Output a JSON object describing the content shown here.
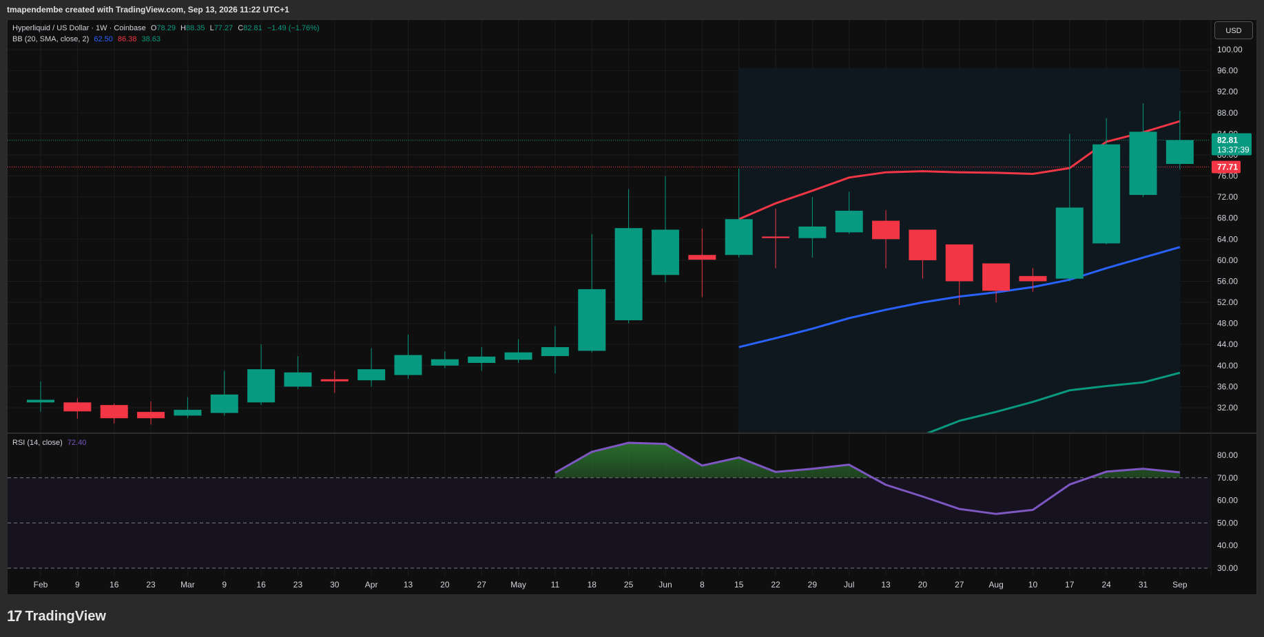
{
  "header": {
    "caption": "tmapendembe created with TradingView.com, Sep 13, 2026 11:22 UTC+1"
  },
  "legend": {
    "symbol": "Hyperliquid / US Dollar · 1W · Coinbase",
    "o_label": "O",
    "o_value": "78.29",
    "h_label": "H",
    "h_value": "88.35",
    "l_label": "L",
    "l_value": "77.27",
    "c_label": "C",
    "c_value": "82.81",
    "change": "−1.49 (−1.76%)",
    "bb_label": "BB (20, SMA, close, 2)",
    "bb_basis": "62.50",
    "bb_upper": "86.38",
    "bb_lower": "38.63",
    "rsi_label": "RSI (14, close)",
    "rsi_value": "72.40"
  },
  "currency_button": "USD",
  "price_tags": {
    "last": "82.81",
    "countdown": "13:37:39",
    "hidden": "80.00",
    "red_line": "77.71"
  },
  "footer": {
    "brand": "TradingView"
  },
  "colors": {
    "up": "#089981",
    "down": "#f23645",
    "bb_upper": "#f23645",
    "bb_basis": "#2962ff",
    "bb_lower": "#089981",
    "rsi": "#7e57c2",
    "background": "#0f0f0f"
  },
  "chart_data": {
    "type": "candlestick",
    "interval": "1W",
    "x_ticks": [
      "Feb",
      "9",
      "16",
      "23",
      "Mar",
      "9",
      "16",
      "23",
      "30",
      "Apr",
      "13",
      "20",
      "27",
      "May",
      "11",
      "18",
      "25",
      "Jun",
      "8",
      "15",
      "22",
      "29",
      "Jul",
      "13",
      "20",
      "27",
      "Aug",
      "10",
      "17",
      "24",
      "31",
      "Sep"
    ],
    "price_axis": {
      "ticks": [
        "100.00",
        "96.00",
        "92.00",
        "88.00",
        "84.00",
        "80.00",
        "76.00",
        "72.00",
        "68.00",
        "64.00",
        "60.00",
        "56.00",
        "52.00",
        "48.00",
        "44.00",
        "40.00",
        "36.00",
        "32.00"
      ],
      "range": [
        28.6,
        103.9
      ]
    },
    "candles": [
      {
        "o": 33.0,
        "h": 37.0,
        "l": 31.2,
        "c": 33.5
      },
      {
        "o": 33.0,
        "h": 33.8,
        "l": 29.9,
        "c": 31.3
      },
      {
        "o": 32.5,
        "h": 32.8,
        "l": 29.0,
        "c": 30.0
      },
      {
        "o": 31.2,
        "h": 33.2,
        "l": 28.8,
        "c": 30.0
      },
      {
        "o": 30.5,
        "h": 34.0,
        "l": 30.0,
        "c": 31.6
      },
      {
        "o": 31.0,
        "h": 39.0,
        "l": 30.5,
        "c": 34.5
      },
      {
        "o": 33.0,
        "h": 44.0,
        "l": 32.5,
        "c": 39.3
      },
      {
        "o": 36.0,
        "h": 41.8,
        "l": 35.5,
        "c": 38.7
      },
      {
        "o": 37.4,
        "h": 39.0,
        "l": 34.8,
        "c": 37.0
      },
      {
        "o": 37.2,
        "h": 43.3,
        "l": 36.0,
        "c": 39.3
      },
      {
        "o": 38.2,
        "h": 45.9,
        "l": 37.5,
        "c": 42.0
      },
      {
        "o": 40.0,
        "h": 42.7,
        "l": 39.5,
        "c": 41.2
      },
      {
        "o": 40.5,
        "h": 43.5,
        "l": 39.0,
        "c": 41.7
      },
      {
        "o": 41.1,
        "h": 45.0,
        "l": 40.5,
        "c": 42.5
      },
      {
        "o": 41.8,
        "h": 47.5,
        "l": 38.5,
        "c": 43.5
      },
      {
        "o": 42.8,
        "h": 65.0,
        "l": 42.5,
        "c": 54.5
      },
      {
        "o": 48.6,
        "h": 73.5,
        "l": 48.0,
        "c": 66.1
      },
      {
        "o": 57.2,
        "h": 76.0,
        "l": 55.8,
        "c": 65.8
      },
      {
        "o": 61.0,
        "h": 66.0,
        "l": 53.0,
        "c": 60.1
      },
      {
        "o": 61.0,
        "h": 77.4,
        "l": 60.5,
        "c": 67.8
      },
      {
        "o": 64.5,
        "h": 69.8,
        "l": 58.5,
        "c": 64.2
      },
      {
        "o": 64.2,
        "h": 72.0,
        "l": 60.5,
        "c": 66.4
      },
      {
        "o": 65.3,
        "h": 73.0,
        "l": 65.0,
        "c": 69.4
      },
      {
        "o": 67.5,
        "h": 69.5,
        "l": 58.5,
        "c": 64.0
      },
      {
        "o": 65.8,
        "h": 65.8,
        "l": 56.5,
        "c": 60.0
      },
      {
        "o": 63.0,
        "h": 63.0,
        "l": 51.5,
        "c": 56.0
      },
      {
        "o": 59.4,
        "h": 59.4,
        "l": 52.0,
        "c": 54.2
      },
      {
        "o": 57.0,
        "h": 58.5,
        "l": 54.0,
        "c": 56.0
      },
      {
        "o": 56.5,
        "h": 84.0,
        "l": 56.0,
        "c": 70.0
      },
      {
        "o": 63.2,
        "h": 87.0,
        "l": 63.0,
        "c": 82.0
      },
      {
        "o": 72.4,
        "h": 89.8,
        "l": 72.0,
        "c": 84.4
      },
      {
        "o": 78.29,
        "h": 88.35,
        "l": 77.27,
        "c": 82.81
      }
    ],
    "bb_start_index": 19,
    "bb_upper": [
      67.8,
      70.8,
      73.2,
      75.7,
      76.7,
      76.9,
      76.7,
      76.6,
      76.4,
      77.5,
      82.5,
      84.3,
      86.4
    ],
    "bb_basis": [
      43.5,
      45.2,
      47.0,
      49.0,
      50.6,
      52.0,
      53.1,
      53.9,
      54.9,
      56.3,
      58.5,
      60.5,
      62.5
    ],
    "bb_lower": [
      19.0,
      20.0,
      21.0,
      22.5,
      24.0,
      26.8,
      29.5,
      31.2,
      33.1,
      35.3,
      36.1,
      36.8,
      38.63
    ],
    "last_price": 82.81,
    "red_line_price": 77.71,
    "rsi": {
      "axis_ticks": [
        "80.00",
        "70.00",
        "60.00",
        "50.00",
        "40.00",
        "30.00"
      ],
      "range": [
        27.5,
        87.0
      ],
      "overbought": 70,
      "middle": 50,
      "oversold": 30,
      "start_index": 14,
      "values": [
        72.2,
        81.5,
        85.5,
        85.0,
        75.4,
        79.0,
        72.6,
        74.0,
        75.8,
        66.9,
        61.7,
        56.2,
        54.0,
        55.8,
        67.0,
        72.7,
        74.0,
        72.4
      ]
    }
  }
}
